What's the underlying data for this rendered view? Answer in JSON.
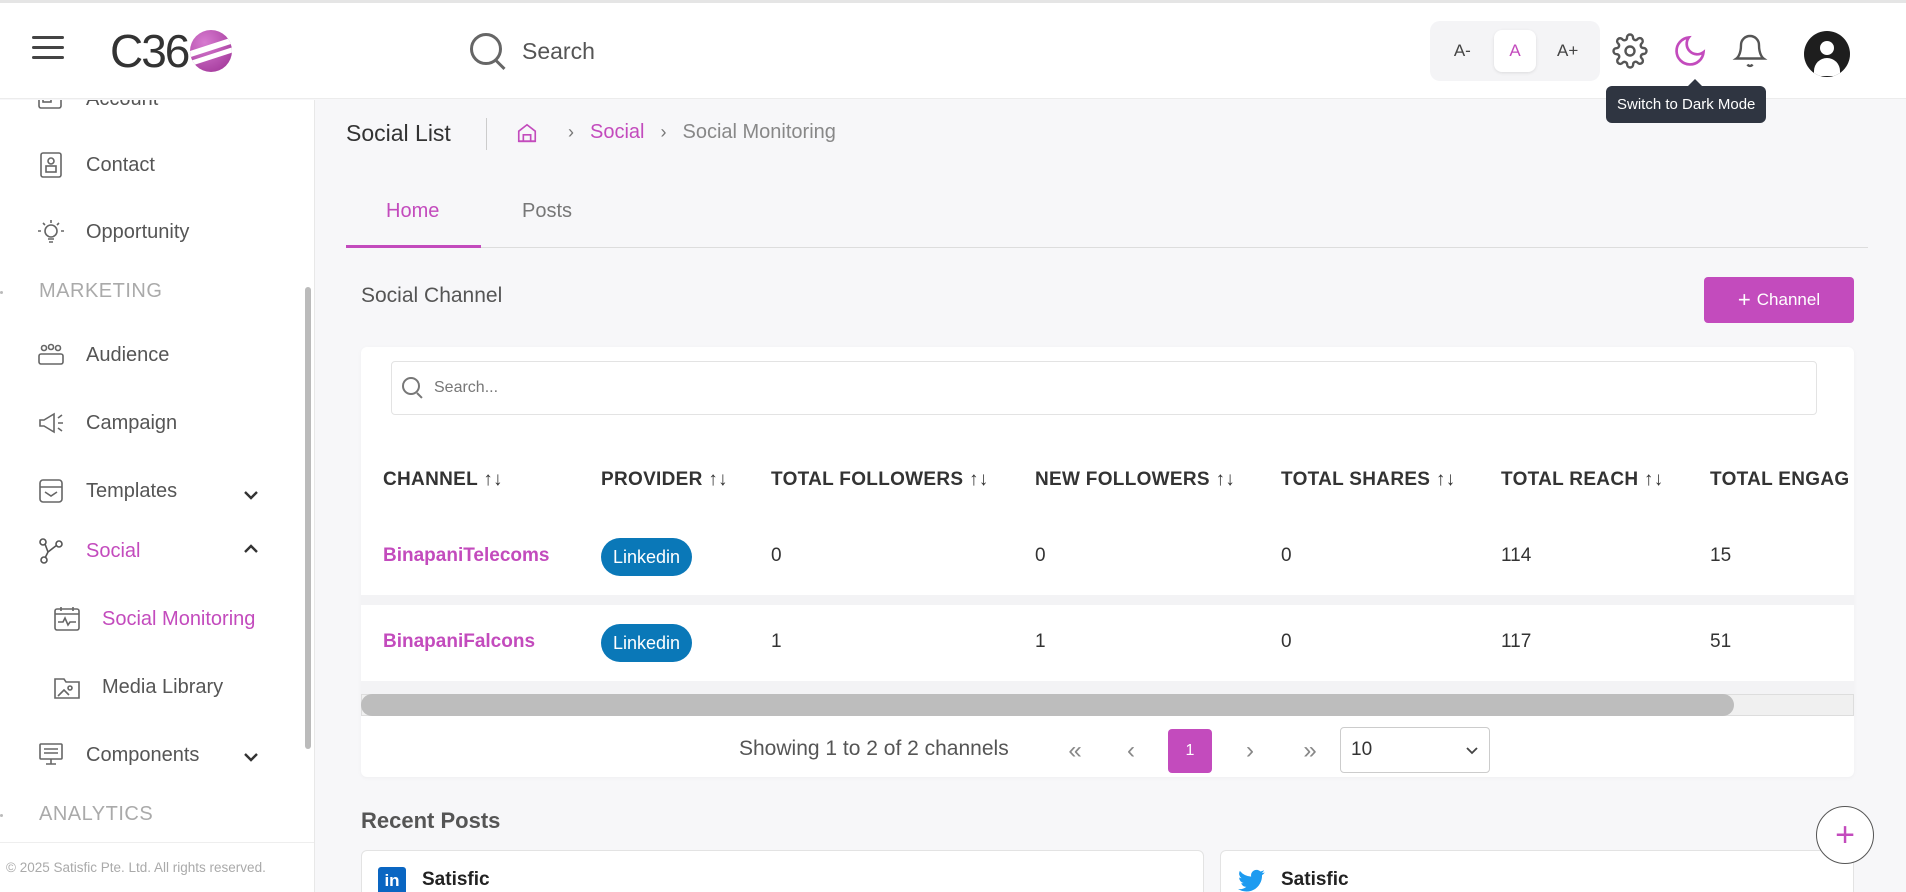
{
  "header": {
    "search_placeholder": "Search",
    "font_small": "A-",
    "font_normal": "A",
    "font_large": "A+",
    "tooltip": "Switch to Dark Mode"
  },
  "sidebar": {
    "items": [
      {
        "label": "Account"
      },
      {
        "label": "Contact"
      },
      {
        "label": "Opportunity"
      },
      {
        "label": "Audience"
      },
      {
        "label": "Campaign"
      },
      {
        "label": "Templates"
      },
      {
        "label": "Social"
      },
      {
        "label": "Social Monitoring"
      },
      {
        "label": "Media Library"
      },
      {
        "label": "Components"
      }
    ],
    "sections": [
      "MARKETING",
      "ANALYTICS"
    ],
    "footer": "© 2025 Satisfic Pte. Ltd. All rights reserved."
  },
  "page": {
    "title": "Social List",
    "breadcrumb": [
      "Social",
      "Social Monitoring"
    ]
  },
  "tabs": [
    "Home",
    "Posts"
  ],
  "channel_section": {
    "title": "Social Channel",
    "add_button": "Channel",
    "search_placeholder": "Search...",
    "columns": [
      "CHANNEL ↑↓",
      "PROVIDER ↑↓",
      "TOTAL FOLLOWERS ↑↓",
      "NEW FOLLOWERS ↑↓",
      "TOTAL SHARES ↑↓",
      "TOTAL REACH ↑↓",
      "TOTAL ENGAG"
    ],
    "rows": [
      {
        "channel": "BinapaniTelecoms",
        "provider": "Linkedin",
        "total_followers": "0",
        "new_followers": "0",
        "total_shares": "0",
        "total_reach": "114",
        "total_engagement": "15"
      },
      {
        "channel": "BinapaniFalcons",
        "provider": "Linkedin",
        "total_followers": "1",
        "new_followers": "1",
        "total_shares": "0",
        "total_reach": "117",
        "total_engagement": "51"
      }
    ],
    "pagination": {
      "summary": "Showing 1 to 2 of 2 channels",
      "current_page": "1",
      "page_size": "10"
    }
  },
  "recent_posts": {
    "title": "Recent Posts",
    "posts": [
      {
        "author": "Satisfic",
        "provider": "linkedin"
      },
      {
        "author": "Satisfic",
        "provider": "twitter"
      }
    ]
  },
  "colors": {
    "accent": "#c34bbd",
    "linkedin": "#0a78b8"
  }
}
